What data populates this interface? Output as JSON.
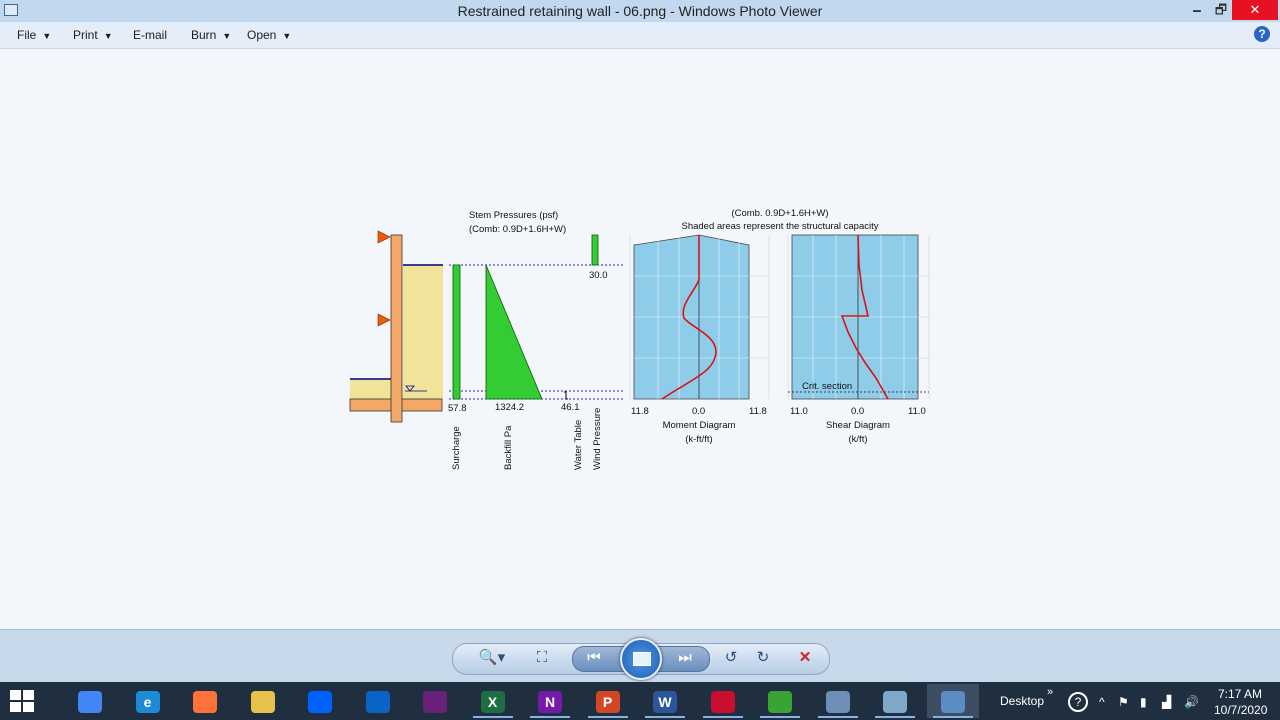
{
  "window": {
    "title": "Restrained retaining wall - 06.png - Windows Photo Viewer",
    "minimize": "🗕",
    "maximize": "🗗",
    "close": "✕"
  },
  "menu": {
    "file": "File",
    "print": "Print",
    "email": "E-mail",
    "burn": "Burn",
    "open": "Open",
    "caret": "▼",
    "help": "?"
  },
  "figure": {
    "stem_title": "Stem Pressures (psf)",
    "stem_comb": "(Comb: 0.9D+1.6H+W)",
    "values": {
      "surcharge": "57.8",
      "backfill": "1324.2",
      "water_table": "46.1",
      "wind": "30.0"
    },
    "load_labels": {
      "surcharge": "Surcharge",
      "backfill": "Backfill Pa",
      "water_table": "Water Table",
      "wind": "Wind Pressure"
    },
    "diagram_comb": "(Comb. 0.9D+1.6H+W)",
    "diagram_note": "Shaded areas represent the structural capacity",
    "moment": {
      "left": "11.8",
      "center": "0.0",
      "right": "11.8",
      "name": "Moment Diagram",
      "unit": "(k-ft/ft)"
    },
    "shear": {
      "left": "11.0",
      "center": "0.0",
      "right": "11.0",
      "name": "Shear Diagram",
      "unit": "(k/ft)",
      "crit": "Crit. section"
    }
  },
  "controls": {
    "zoom": "🔍▾",
    "fit": "⛶",
    "prev": "⏮",
    "next": "⏭",
    "rotate_ccw": "↺",
    "rotate_cw": "↻",
    "delete": "✕"
  },
  "taskbar": {
    "apps": [
      {
        "icon": "chrome-icon",
        "glyph": "",
        "color": "#4285f4"
      },
      {
        "icon": "edge-icon",
        "glyph": "e",
        "color": "#1c8ad6"
      },
      {
        "icon": "firefox-icon",
        "glyph": "",
        "color": "#ff7139"
      },
      {
        "icon": "file-explorer-icon",
        "glyph": "",
        "color": "#e8c14a"
      },
      {
        "icon": "dropbox-icon",
        "glyph": "",
        "color": "#0061fe"
      },
      {
        "icon": "onedrive-icon",
        "glyph": "",
        "color": "#0a64c8"
      },
      {
        "icon": "visual-studio-icon",
        "glyph": "",
        "color": "#68217a"
      },
      {
        "icon": "excel-icon",
        "glyph": "X",
        "color": "#1d6f42"
      },
      {
        "icon": "onenote-icon",
        "glyph": "N",
        "color": "#7719aa"
      },
      {
        "icon": "powerpoint-icon",
        "glyph": "P",
        "color": "#d24726"
      },
      {
        "icon": "word-icon",
        "glyph": "W",
        "color": "#2b579a"
      },
      {
        "icon": "app-icon-red",
        "glyph": "",
        "color": "#c8102e"
      },
      {
        "icon": "green-arrow-icon",
        "glyph": "",
        "color": "#3aa335"
      },
      {
        "icon": "tools-icon",
        "glyph": "",
        "color": "#6e8fb5"
      },
      {
        "icon": "notepad-icon",
        "glyph": "",
        "color": "#7fa8c9"
      },
      {
        "icon": "photo-viewer-icon",
        "glyph": "",
        "color": "#5b8cc4"
      }
    ],
    "desktop": "Desktop",
    "chevron": "»",
    "help": "?",
    "up": "^",
    "time": "7:17 AM",
    "date": "10/7/2020"
  }
}
